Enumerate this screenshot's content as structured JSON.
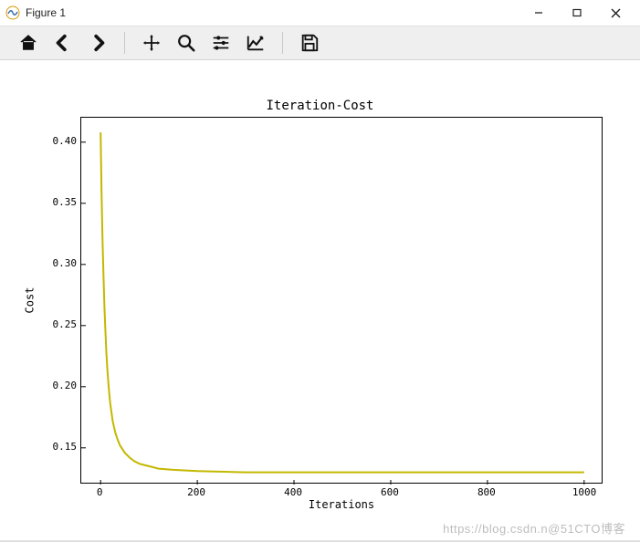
{
  "window": {
    "title": "Figure 1",
    "buttons": {
      "minimize": "–",
      "maximize": "□",
      "close": "×"
    }
  },
  "toolbar": {
    "items": [
      {
        "name": "home-icon"
      },
      {
        "name": "back-icon"
      },
      {
        "name": "forward-icon"
      },
      {
        "sep": true
      },
      {
        "name": "pan-icon"
      },
      {
        "name": "zoom-icon"
      },
      {
        "name": "configure-icon"
      },
      {
        "name": "edit-axes-icon"
      },
      {
        "sep": true
      },
      {
        "name": "save-icon"
      }
    ]
  },
  "watermark": "https://blog.csdn.n@51CTO博客",
  "chart_data": {
    "type": "line",
    "title": "Iteration-Cost",
    "xlabel": "Iterations",
    "ylabel": "Cost",
    "xlim": [
      -40,
      1040
    ],
    "ylim": [
      0.12,
      0.42
    ],
    "xticks": [
      0,
      200,
      400,
      600,
      800,
      1000
    ],
    "yticks": [
      0.15,
      0.2,
      0.25,
      0.3,
      0.35,
      0.4
    ],
    "ytick_labels": [
      "0.15",
      "0.20",
      "0.25",
      "0.30",
      "0.35",
      "0.40"
    ],
    "series": [
      {
        "name": "cost",
        "color": "#c3b800",
        "x": [
          0,
          2,
          4,
          6,
          8,
          10,
          12,
          14,
          16,
          18,
          20,
          25,
          30,
          35,
          40,
          50,
          60,
          70,
          80,
          90,
          100,
          120,
          150,
          200,
          300,
          400,
          500,
          600,
          700,
          800,
          900,
          1000
        ],
        "y": [
          0.408,
          0.36,
          0.32,
          0.29,
          0.265,
          0.245,
          0.228,
          0.214,
          0.203,
          0.194,
          0.186,
          0.172,
          0.163,
          0.157,
          0.152,
          0.146,
          0.142,
          0.139,
          0.137,
          0.136,
          0.135,
          0.133,
          0.132,
          0.131,
          0.13,
          0.13,
          0.13,
          0.13,
          0.13,
          0.13,
          0.13,
          0.13
        ]
      }
    ]
  }
}
